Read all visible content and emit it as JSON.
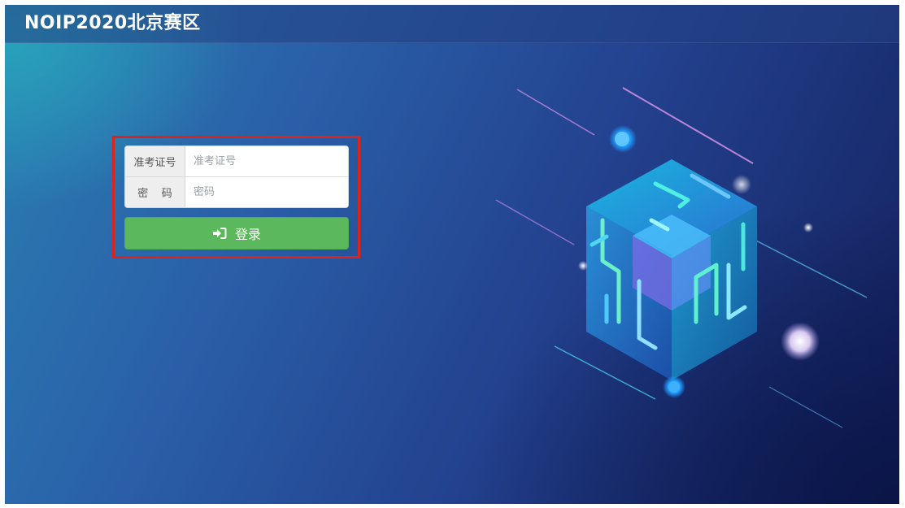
{
  "header": {
    "title": "NOIP2020北京赛区"
  },
  "login": {
    "admission_label": "准考证号",
    "admission_placeholder": "准考证号",
    "password_label": "密    码",
    "password_placeholder": "密码",
    "submit_label": "登录",
    "submit_icon": "sign-in-icon"
  },
  "colors": {
    "highlight_border": "#d9241f",
    "button_green": "#5cb85c",
    "header_bar": "#22408299"
  }
}
